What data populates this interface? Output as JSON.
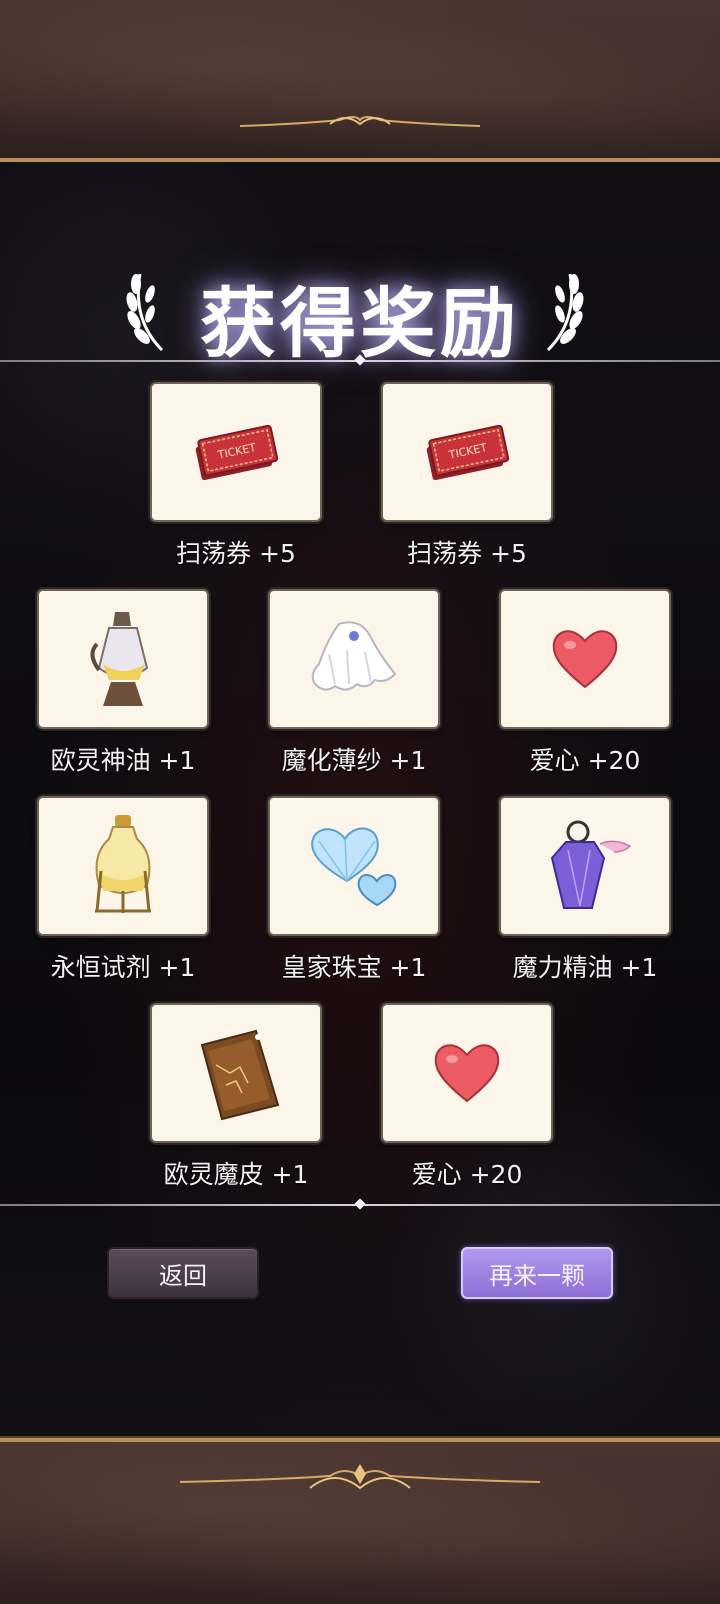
{
  "title": "获得奖励",
  "rewards": [
    {
      "name": "扫荡券 +5",
      "icon": "ticket-icon"
    },
    {
      "name": "扫荡券 +5",
      "icon": "ticket-icon"
    },
    {
      "name": "欧灵神油 +1",
      "icon": "oil-flask-icon"
    },
    {
      "name": "魔化薄纱 +1",
      "icon": "veil-icon"
    },
    {
      "name": "爱心 +20",
      "icon": "heart-icon"
    },
    {
      "name": "永恒试剂 +1",
      "icon": "potion-bottle-icon"
    },
    {
      "name": "皇家珠宝 +1",
      "icon": "diamond-hearts-icon"
    },
    {
      "name": "魔力精油 +1",
      "icon": "purple-vial-icon"
    },
    {
      "name": "欧灵魔皮 +1",
      "icon": "leather-scroll-icon"
    },
    {
      "name": "爱心 +20",
      "icon": "heart-icon"
    }
  ],
  "buttons": {
    "back": "返回",
    "again": "再来一颗"
  },
  "colors": {
    "frame": "#3a2926",
    "gold_trim": "#b8905a",
    "card_bg": "#fbf5ea",
    "again_button": "#9d82e2",
    "back_button": "#4c3e4e"
  }
}
